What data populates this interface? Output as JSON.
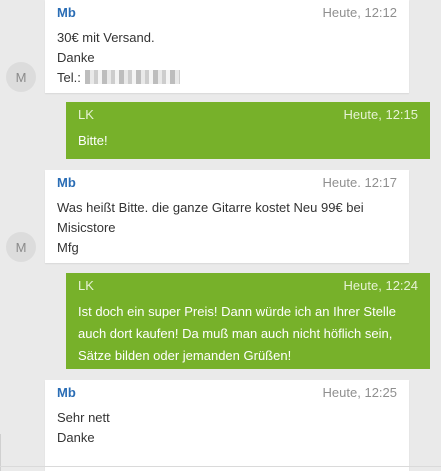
{
  "messages": [
    {
      "sender": "Mb",
      "time": "Heute, 12:12",
      "lines": [
        "30€ mit Versand.",
        "Danke",
        "Tel.:"
      ],
      "avatar": "M"
    },
    {
      "sender": "LK",
      "time": "Heute, 12:15",
      "lines": [
        "Bitte!"
      ]
    },
    {
      "sender": "Mb",
      "time": "Heute. 12:17",
      "lines": [
        "Was heißt Bitte. die ganze Gitarre kostet Neu 99€ bei",
        "Misicstore",
        "Mfg"
      ],
      "avatar": "M"
    },
    {
      "sender": "LK",
      "time": "Heute, 12:24",
      "lines": [
        "Ist doch ein super Preis! Dann würde ich an Ihrer Stelle",
        "auch dort kaufen! Da muß man auch nicht höflich sein,",
        "Sätze bilden oder jemanden Grüßen!"
      ]
    },
    {
      "sender": "Mb",
      "time": "Heute, 12:25",
      "lines": [
        "Sehr nett",
        "Danke"
      ]
    }
  ],
  "colors": {
    "outgoing_bg": "#77b12a",
    "incoming_bg": "#ffffff",
    "sender_in": "#2a6db5"
  }
}
